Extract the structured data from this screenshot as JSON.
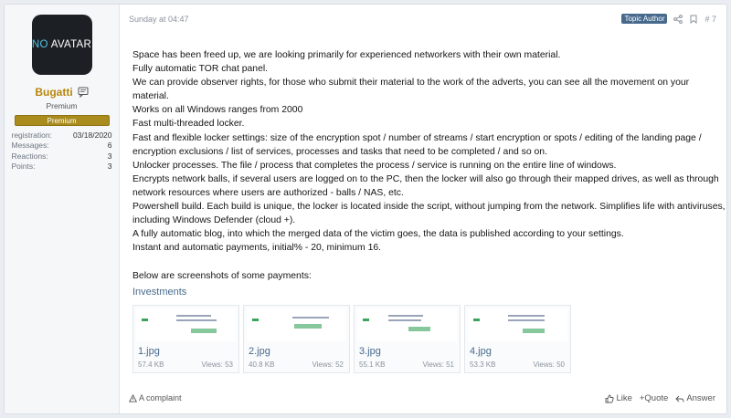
{
  "user": {
    "avatar_text_1": "NO",
    "avatar_text_2": "AVATAR",
    "name": "Bugatti",
    "title": "Premium",
    "badge": "Premium",
    "stats": [
      {
        "label": "registration:",
        "value": "03/18/2020"
      },
      {
        "label": "Messages:",
        "value": "6"
      },
      {
        "label": "Reactions:",
        "value": "3"
      },
      {
        "label": "Points:",
        "value": "3"
      }
    ]
  },
  "post": {
    "date": "Sunday at 04:47",
    "author_tag": "Topic Author",
    "number": "# 7",
    "paragraphs": [
      "Space has been freed up, we are looking primarily for experienced networkers with their own material.",
      "Fully automatic TOR chat panel.",
      "We can provide observer rights, for those who submit their material to the work of the adverts, you can see all the movement on your material.",
      "Works on all Windows ranges from 2000",
      "Fast multi-threaded locker.",
      "Fast and flexible locker settings: size of the encryption spot / number of streams / start encryption or spots / editing of the landing page / encryption exclusions / list of services, processes and tasks that need to be completed / and so on.",
      "Unlocker processes. The file / process that completes the process / service is running on the entire line of windows.",
      "Encrypts network balls, if several users are logged on to the PC, then the locker will also go through their mapped drives, as well as through network resources where users are authorized - balls / NAS, etc.",
      "Powershell build. Each build is unique, the locker is located inside the script, without jumping from the network. Simplifies life with antiviruses, including Windows Defender (cloud +).",
      "A fully automatic blog, into which the merged data of the victim goes, the data is published according to your settings.",
      "Instant and automatic payments, initial% - 20, minimum 16."
    ],
    "closing": "Below are screenshots of some payments:",
    "attachments_title": "Investments",
    "attachments": [
      {
        "name": "1.jpg",
        "size": "57.4 KB",
        "views": "Views: 53"
      },
      {
        "name": "2.jpg",
        "size": "40.8 KB",
        "views": "Views: 52"
      },
      {
        "name": "3.jpg",
        "size": "55.1 KB",
        "views": "Views: 51"
      },
      {
        "name": "4.jpg",
        "size": "53.3 KB",
        "views": "Views: 50"
      }
    ]
  },
  "footer": {
    "complaint": "A complaint",
    "like": "Like",
    "quote": "+Quote",
    "answer": "Answer"
  },
  "colors": {
    "link": "#47698c",
    "username": "#b8860b",
    "badge": "#a98b1e",
    "author_tag": "#47698c"
  }
}
